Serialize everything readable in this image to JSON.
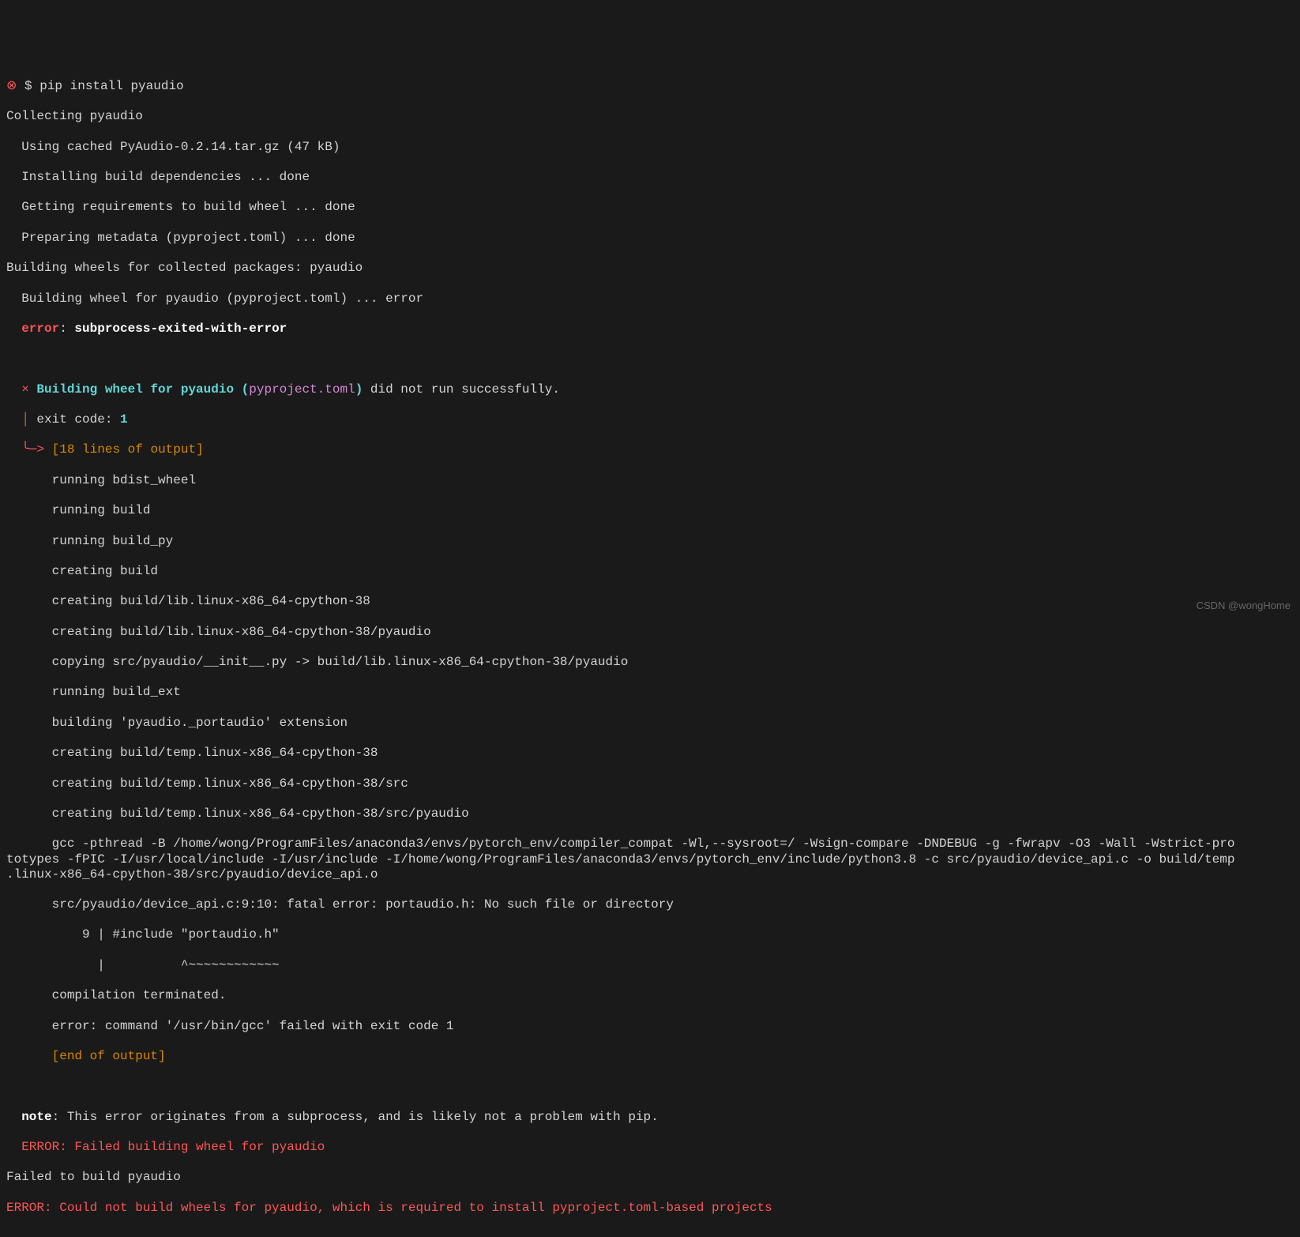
{
  "lines": {
    "cmd_prefix_x": "⊗",
    "cmd_prompt": " $ ",
    "cmd_text": "pip install pyaudio",
    "l1": "Collecting pyaudio",
    "l2": "  Using cached PyAudio-0.2.14.tar.gz (47 kB)",
    "l3": "  Installing build dependencies ... done",
    "l4": "  Getting requirements to build wheel ... done",
    "l5": "  Preparing metadata (pyproject.toml) ... done",
    "l6": "Building wheels for collected packages: pyaudio",
    "l7": "  Building wheel for pyaudio (pyproject.toml) ... error",
    "l8_error": "  error",
    "l8_colon": ": ",
    "l8_msg": "subprocess-exited-with-error",
    "l9": "  ",
    "l10_x": "  × ",
    "l10_a": "Building wheel for pyaudio ",
    "l10_b": "(",
    "l10_c": "pyproject.toml",
    "l10_d": ")",
    "l10_e": " did not run successfully.",
    "l11_pipe": "  │ ",
    "l11_a": "exit code: ",
    "l11_b": "1",
    "l12_arrow": "  ╰─> ",
    "l12_a": "[18 lines of output]",
    "l13": "      running bdist_wheel",
    "l14": "      running build",
    "l15": "      running build_py",
    "l16": "      creating build",
    "l17": "      creating build/lib.linux-x86_64-cpython-38",
    "l18": "      creating build/lib.linux-x86_64-cpython-38/pyaudio",
    "l19": "      copying src/pyaudio/__init__.py -> build/lib.linux-x86_64-cpython-38/pyaudio",
    "l20": "      running build_ext",
    "l21": "      building 'pyaudio._portaudio' extension",
    "l22": "      creating build/temp.linux-x86_64-cpython-38",
    "l23": "      creating build/temp.linux-x86_64-cpython-38/src",
    "l24": "      creating build/temp.linux-x86_64-cpython-38/src/pyaudio",
    "l25": "      gcc -pthread -B /home/wong/ProgramFiles/anaconda3/envs/pytorch_env/compiler_compat -Wl,--sysroot=/ -Wsign-compare -DNDEBUG -g -fwrapv -O3 -Wall -Wstrict-pro\ntotypes -fPIC -I/usr/local/include -I/usr/include -I/home/wong/ProgramFiles/anaconda3/envs/pytorch_env/include/python3.8 -c src/pyaudio/device_api.c -o build/temp\n.linux-x86_64-cpython-38/src/pyaudio/device_api.o",
    "l26": "      src/pyaudio/device_api.c:9:10: fatal error: portaudio.h: No such file or directory",
    "l27": "          9 | #include \"portaudio.h\"",
    "l28": "            |          ^~~~~~~~~~~~~",
    "l29": "      compilation terminated.",
    "l30": "      error: command '/usr/bin/gcc' failed with exit code 1",
    "l31": "      [end of output]",
    "l32": "  ",
    "l33_note": "  note",
    "l33_msg": ": This error originates from a subprocess, and is likely not a problem with pip.",
    "l34": "  ERROR: Failed building wheel for pyaudio",
    "l35": "Failed to build pyaudio",
    "l36": "ERROR: Could not build wheels for pyaudio, which is required to install pyproject.toml-based projects"
  },
  "watermark": "CSDN @wongHome"
}
